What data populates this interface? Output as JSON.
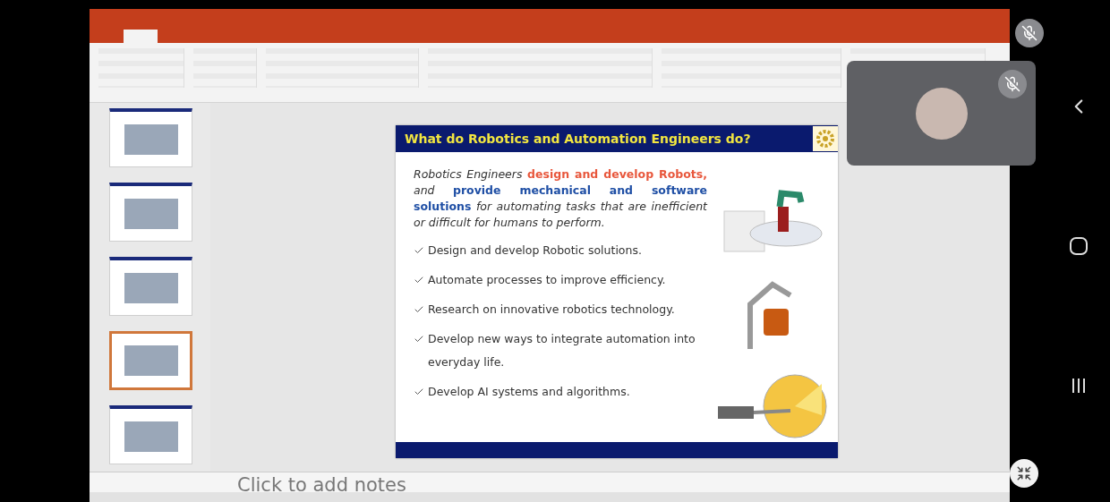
{
  "slide": {
    "title": "What do Robotics and Automation Engineers do?",
    "intro": [
      {
        "text": "Robotics Engineers ",
        "kind": "plain"
      },
      {
        "text": "design and develop Robots,",
        "kind": "accent"
      },
      {
        "text": " and ",
        "kind": "plain"
      },
      {
        "text": "provide mechanical and software solutions",
        "kind": "strong"
      },
      {
        "text": " for automating tasks that are inefficient or difficult for humans to perform.",
        "kind": "plain"
      }
    ],
    "bullets": [
      "Design and develop Robotic solutions.",
      "Automate processes to improve efficiency.",
      "Research on innovative robotics technology.",
      "Develop new ways to integrate automation into everyday life.",
      "Develop AI systems and algorithms."
    ]
  },
  "thumbnails": [
    {
      "selected": false
    },
    {
      "selected": false
    },
    {
      "selected": false
    },
    {
      "selected": true
    },
    {
      "selected": false
    }
  ],
  "notes": {
    "placeholder": "Click to add notes"
  },
  "participant": {
    "muted": true
  },
  "self": {
    "muted": true
  }
}
